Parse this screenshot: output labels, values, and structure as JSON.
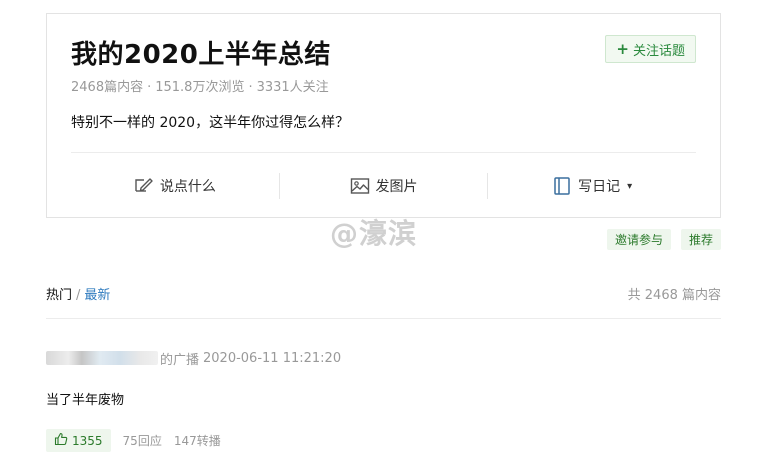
{
  "topic": {
    "title": "我的2020上半年总结",
    "follow_label": "关注话题",
    "stats": {
      "posts": "2468篇内容",
      "views": "151.8万次浏览",
      "followers": "3331人关注",
      "separator": "·"
    },
    "description": "特别不一样的 2020，这半年你过得怎么样？",
    "actions": [
      {
        "label": "说点什么",
        "icon": "pen-icon"
      },
      {
        "label": "发图片",
        "icon": "image-icon"
      },
      {
        "label": "写日记",
        "icon": "book-icon",
        "caret": "▾"
      }
    ]
  },
  "watermark": "@濠滨",
  "tags": [
    "邀请参与",
    "推荐"
  ],
  "list": {
    "tab_hot": "热门",
    "tab_separator": "/",
    "tab_new": "最新",
    "total": "共 2468 篇内容"
  },
  "post": {
    "action_text": "的广播",
    "time": "2020-06-11 11:21:20",
    "body": "当了半年废物",
    "likes": "1355",
    "replies": "75回应",
    "reposts": "147转播"
  },
  "colors": {
    "accent_green": "#2b8a3e",
    "tag_bg": "#eef6ed",
    "link_blue": "#2f7bbf",
    "muted_text": "#999999"
  }
}
